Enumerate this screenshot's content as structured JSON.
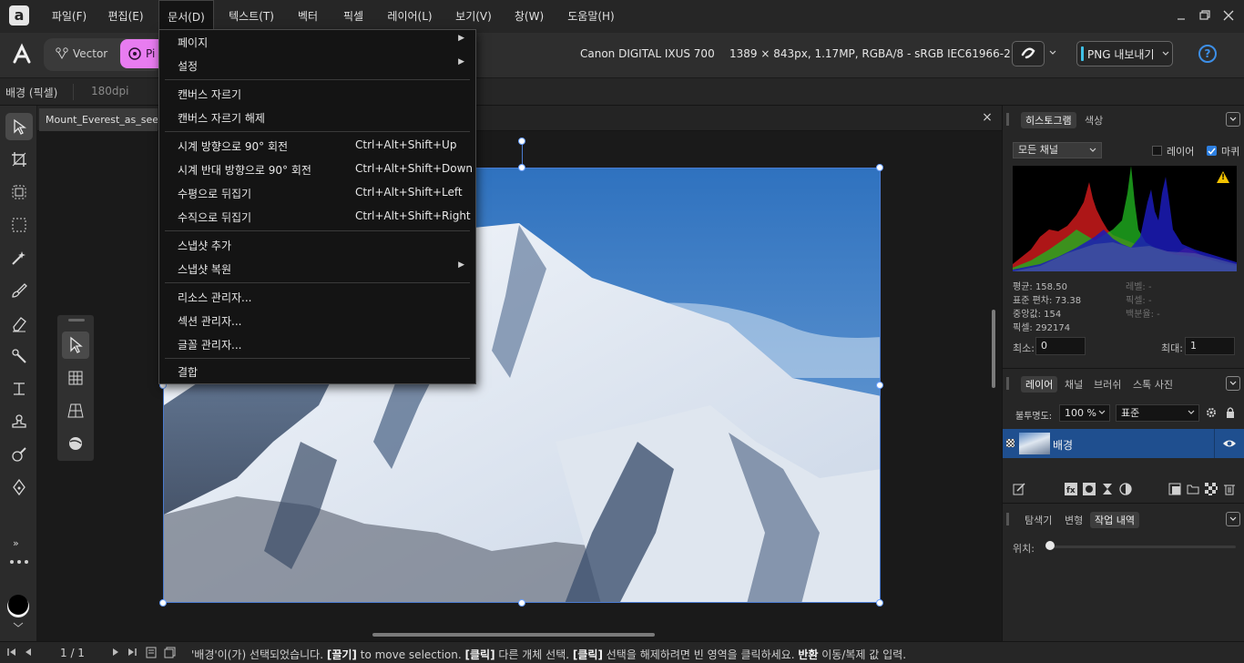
{
  "menubar": {
    "logo": "a",
    "items": [
      "파일(F)",
      "편집(E)",
      "문서(D)",
      "텍스트(T)",
      "벡터",
      "픽셀",
      "레이어(L)",
      "보기(V)",
      "창(W)",
      "도움말(H)"
    ]
  },
  "toolbar": {
    "vector_label": "Vector",
    "pixel_label": "Pi",
    "camera": "Canon DIGITAL IXUS 700",
    "image_info": "1389 × 843px, 1.17MP, RGBA/8 - sRGB IEC61966-2.1",
    "export_label": "PNG 내보내기",
    "help": "?"
  },
  "context": {
    "layer_type": "배경 (픽셀)",
    "dpi": "180dpi"
  },
  "document": {
    "tab_title": "Mount_Everest_as_seen_f",
    "close": "×"
  },
  "docmenu": {
    "items": [
      {
        "label": "페이지",
        "shortcut": "",
        "submenu": true
      },
      {
        "label": "설정",
        "shortcut": "",
        "submenu": true
      },
      {
        "label": "캔버스 자르기",
        "shortcut": "",
        "submenu": false
      },
      {
        "label": "캔버스 자르기 해제",
        "shortcut": "",
        "submenu": false
      },
      {
        "label": "시계 방향으로 90° 회전",
        "shortcut": "Ctrl+Alt+Shift+Up",
        "submenu": false
      },
      {
        "label": "시계 반대 방향으로 90° 회전",
        "shortcut": "Ctrl+Alt+Shift+Down",
        "submenu": false
      },
      {
        "label": "수평으로 뒤집기",
        "shortcut": "Ctrl+Alt+Shift+Left",
        "submenu": false
      },
      {
        "label": "수직으로 뒤집기",
        "shortcut": "Ctrl+Alt+Shift+Right",
        "submenu": false
      },
      {
        "label": "스냅샷 추가",
        "shortcut": "",
        "submenu": false
      },
      {
        "label": "스냅샷 복원",
        "shortcut": "",
        "submenu": true
      },
      {
        "label": "리소스 관리자...",
        "shortcut": "",
        "submenu": false
      },
      {
        "label": "섹션 관리자...",
        "shortcut": "",
        "submenu": false
      },
      {
        "label": "글꼴 관리자...",
        "shortcut": "",
        "submenu": false
      },
      {
        "label": "결합",
        "shortcut": "",
        "submenu": false
      }
    ],
    "submenu_arrow": "▶"
  },
  "histogram": {
    "tabs": [
      "히스토그램",
      "색상"
    ],
    "channel": "모든 채널",
    "layer_label": "레이어",
    "marquee_label": "마퀴",
    "mean": "평균: 158.50",
    "stddev": "표준 편차: 73.38",
    "median": "중앙값: 154",
    "pixels": "픽셀: 292174",
    "level": "레벨: -",
    "pixel_r": "픽셀: -",
    "percentile": "백분율: -",
    "min_label": "최소:",
    "min_value": "0",
    "max_label": "최대:",
    "max_value": "1",
    "warning": "!"
  },
  "layers": {
    "tabs": [
      "레이어",
      "채널",
      "브러쉬",
      "스톡 사진"
    ],
    "opacity_label": "불투명도:",
    "opacity_value": "100 %",
    "blend_mode": "표준",
    "layer_name": "배경"
  },
  "history": {
    "tabs": [
      "탐색기",
      "변형",
      "작업 내역"
    ],
    "position_label": "위치:",
    "position_value": 0.0
  },
  "statusbar": {
    "page": "1 / 1",
    "msg_1": "'배경'이(가) 선택되었습니다. ",
    "msg_2": "[끌기]",
    "msg_3": " to move selection. ",
    "msg_4": "[클릭]",
    "msg_5": " 다른 개체 선택. ",
    "msg_6": "[클릭]",
    "msg_7": " 선택을 해제하려면 빈 영역을 클릭하세요. ",
    "msg_8": "반환",
    "msg_9": " 이동/복제 값 입력."
  },
  "colors": {
    "accent": "#4a7bd0",
    "pixel_persona": "#e87cf0",
    "layer_selected": "#1f4f8f"
  }
}
